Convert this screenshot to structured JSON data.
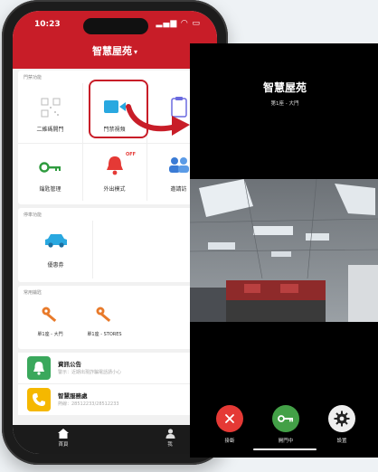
{
  "phone1": {
    "status": {
      "time": "10:23",
      "system": "▂▄▆ ◠ ▭"
    },
    "header": {
      "title": "智慧屋苑",
      "caret": "▾"
    },
    "section1": {
      "label": "門禁功能",
      "tiles": [
        {
          "label": "二維碼開門"
        },
        {
          "label": "門禁視頻"
        },
        {
          "label": ""
        },
        {
          "label": "鑰匙管理"
        },
        {
          "label": "外出模式",
          "badge": "OFF"
        },
        {
          "label": "邀請訪"
        }
      ]
    },
    "section2": {
      "label": "停車功能",
      "tiles": [
        {
          "label": "優惠券"
        }
      ]
    },
    "section3": {
      "label": "常用鑰匙",
      "keys": [
        {
          "label": "單1座 - 大門"
        },
        {
          "label": "單1座 - STORES"
        }
      ]
    },
    "rows": [
      {
        "title": "資訊公告",
        "subtitle": "警示：近期出現詐騙電話請小心"
      },
      {
        "title": "智慧服務處",
        "subtitle": "熱線：28512233/28512233"
      }
    ],
    "tabbar": [
      {
        "label": "首頁"
      },
      {
        "label": "我"
      }
    ]
  },
  "phone2": {
    "title": "智慧屋苑",
    "subtitle": "第1座 - 大門",
    "buttons": [
      {
        "label": "掛斷",
        "color": "#e53935"
      },
      {
        "label": "開門中",
        "color": "#43a047"
      },
      {
        "label": "設置",
        "color": "#eeeeee"
      }
    ]
  },
  "colors": {
    "brand_red": "#c81d28",
    "tile_blue": "#29a8e0",
    "key_orange": "#e87a2a",
    "bell_green": "#3aa85c",
    "phone_yellow": "#f5b800"
  }
}
